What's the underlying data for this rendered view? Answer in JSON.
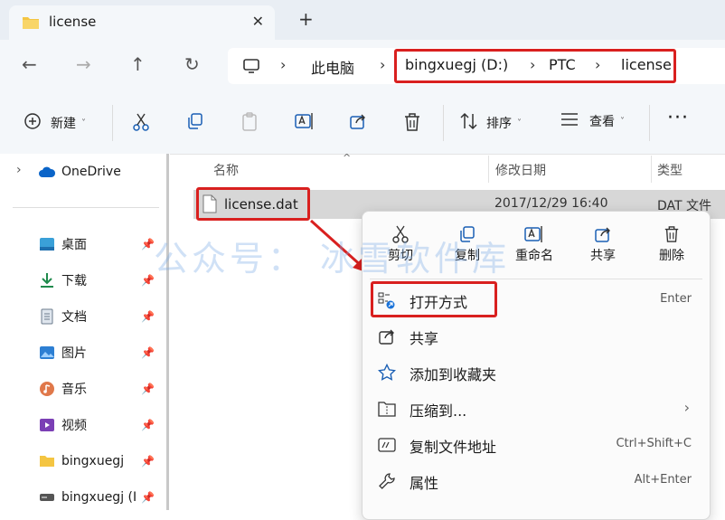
{
  "window": {
    "tab_title": "license"
  },
  "address": {
    "crumbs": [
      "此电脑",
      "bingxuegj (D:)",
      "PTC",
      "license"
    ]
  },
  "toolbar": {
    "new_label": "新建",
    "sort_label": "排序",
    "view_label": "查看"
  },
  "sidebar": {
    "onedrive": "OneDrive",
    "items": [
      "桌面",
      "下载",
      "文档",
      "图片",
      "音乐",
      "视频",
      "bingxuegj",
      "bingxuegj (I"
    ]
  },
  "columns": {
    "name": "名称",
    "modified": "修改日期",
    "type": "类型"
  },
  "file": {
    "name": "license.dat",
    "modified": "2017/12/29 16:40",
    "type": "DAT 文件"
  },
  "context_menu": {
    "quick_actions": [
      "剪切",
      "复制",
      "重命名",
      "共享",
      "删除"
    ],
    "items": [
      {
        "label": "打开方式",
        "shortcut": "Enter"
      },
      {
        "label": "共享",
        "shortcut": ""
      },
      {
        "label": "添加到收藏夹",
        "shortcut": ""
      },
      {
        "label": "压缩到...",
        "shortcut": ""
      },
      {
        "label": "复制文件地址",
        "shortcut": "Ctrl+Shift+C"
      },
      {
        "label": "属性",
        "shortcut": "Alt+Enter"
      }
    ]
  },
  "watermark": "公众号：  冰雪软件库",
  "colors": {
    "highlight": "#d9201f",
    "accent": "#0067c0"
  }
}
